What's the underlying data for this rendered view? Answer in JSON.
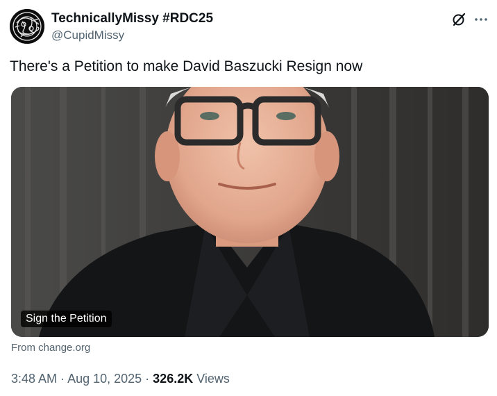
{
  "author": {
    "display_name": "TechnicallyMissy #RDC25",
    "handle": "@CupidMissy"
  },
  "icons": {
    "grok": "grok-icon",
    "more": "more-options-icon"
  },
  "tweet": {
    "text": "There's a Petition to make David Baszucki Resign now"
  },
  "card": {
    "title": "Sign the Petition",
    "source": "From change.org"
  },
  "meta": {
    "time": "3:48 AM",
    "separator1": " · ",
    "date": "Aug 10, 2025",
    "separator2": " · ",
    "views_count": "326.2K",
    "views_label": " Views"
  },
  "colors": {
    "text_primary": "#0f1419",
    "text_secondary": "#536471",
    "background": "#ffffff"
  }
}
